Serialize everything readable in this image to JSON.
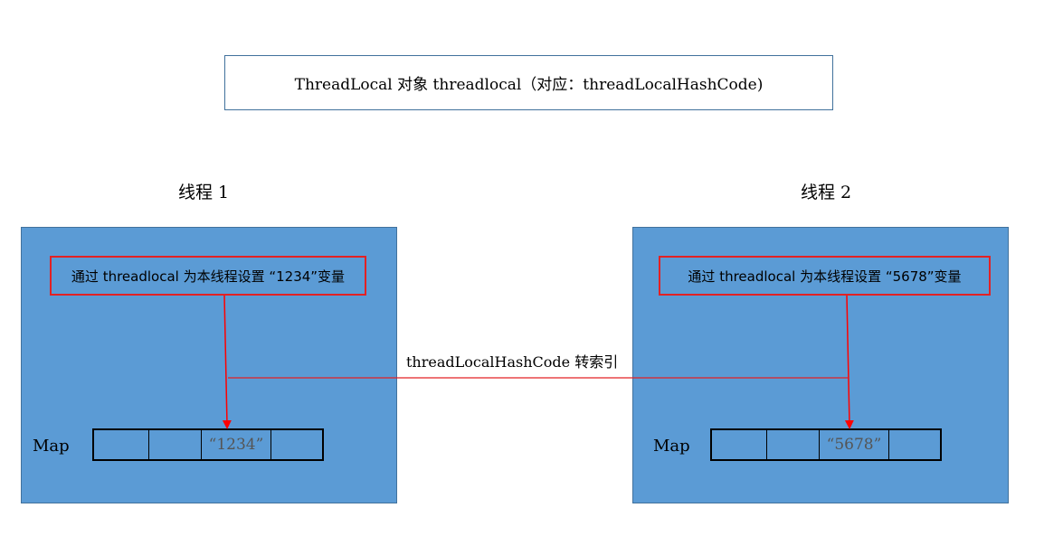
{
  "header": {
    "label": "ThreadLocal 对象 threadlocal（对应：threadLocalHashCode)"
  },
  "threads": [
    {
      "title": "线程 1",
      "action": "通过 threadlocal 为本线程设置 “1234”变量",
      "map_label": "Map",
      "cells": [
        "",
        "",
        "“1234”",
        ""
      ]
    },
    {
      "title": "线程 2",
      "action": "通过 threadlocal 为本线程设置 “5678”变量",
      "map_label": "Map",
      "cells": [
        "",
        "",
        "“5678”",
        ""
      ]
    }
  ],
  "connector": {
    "label": "threadLocalHashCode 转索引"
  },
  "colors": {
    "thread_fill": "#5b9bd5",
    "thread_border": "#41719c",
    "highlight": "#e32124"
  }
}
